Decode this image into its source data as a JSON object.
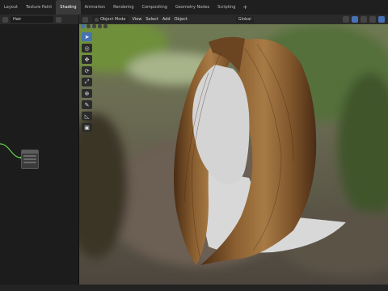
{
  "workspace_tabs": [
    "Layout",
    "Texture Paint",
    "Shading",
    "Animation",
    "Rendering",
    "Compositing",
    "Geometry Nodes",
    "Scripting"
  ],
  "active_tab": "Shading",
  "add_tab_symbol": "+",
  "left_panel": {
    "object_name": "Hair"
  },
  "viewport_header": {
    "mode": "Object Mode",
    "menus": [
      "View",
      "Select",
      "Add",
      "Object"
    ],
    "orientation": "Global"
  },
  "toolbar_icons": [
    "cursor-icon",
    "select-circle-icon",
    "move-icon",
    "rotate-icon",
    "scale-icon",
    "transform-icon",
    "annotate-icon",
    "measure-icon",
    "add-cube-icon"
  ],
  "colors": {
    "accent": "#4772b3",
    "node_wire": "#5fcf4a",
    "hair_dark": "#5a371a",
    "hair_light": "#a87b45"
  }
}
